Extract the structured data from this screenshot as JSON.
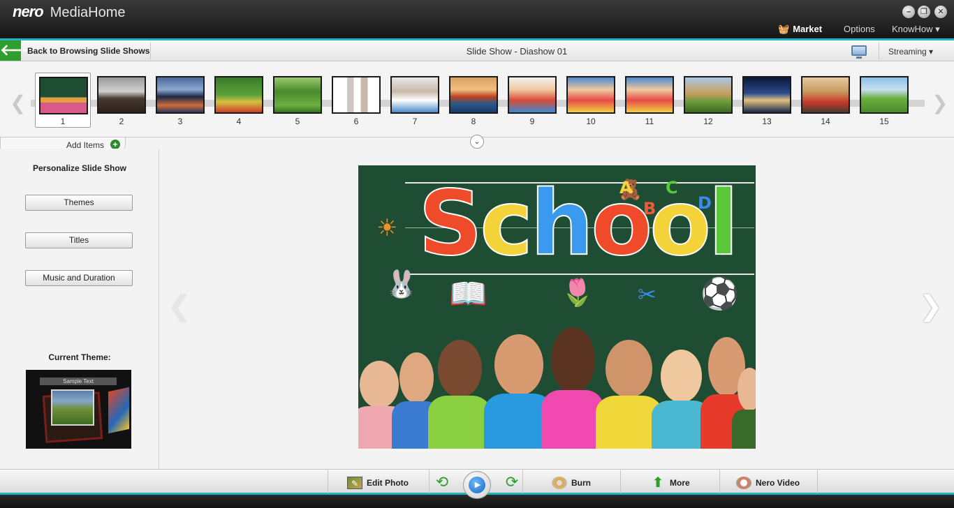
{
  "titlebar": {
    "brand": "nero",
    "app_name": "MediaHome",
    "window_controls": {
      "minimize_icon": "minimize-icon",
      "restore_icon": "restore-icon",
      "close_icon": "close-icon"
    },
    "menu": {
      "market": "Market",
      "options": "Options",
      "knowhow": "KnowHow"
    }
  },
  "navbar": {
    "back_label": "Back to Browsing Slide Shows",
    "title": "Slide Show - Diashow 01",
    "streaming_label": "Streaming",
    "icons": {
      "back": "back-arrow-icon",
      "monitor": "monitor-icon"
    }
  },
  "filmstrip": {
    "selected_index": 1,
    "thumbnails": [
      {
        "number": "1"
      },
      {
        "number": "2"
      },
      {
        "number": "3"
      },
      {
        "number": "4"
      },
      {
        "number": "5"
      },
      {
        "number": "6"
      },
      {
        "number": "7"
      },
      {
        "number": "8"
      },
      {
        "number": "9"
      },
      {
        "number": "10"
      },
      {
        "number": "11"
      },
      {
        "number": "12"
      },
      {
        "number": "13"
      },
      {
        "number": "14"
      },
      {
        "number": "15"
      }
    ],
    "add_items_label": "Add Items"
  },
  "left_panel": {
    "heading": "Personalize Slide Show",
    "buttons": {
      "themes": "Themes",
      "titles": "Titles",
      "music": "Music and Duration"
    },
    "current_theme_label": "Current Theme:",
    "theme_sample_text": "Sample Text"
  },
  "main_photo": {
    "headline": "School",
    "doodles": {
      "abc_a": "A",
      "abc_b": "B",
      "abc_c": "C",
      "abc_d": "D"
    }
  },
  "bottombar": {
    "edit_photo": "Edit Photo",
    "burn": "Burn",
    "more": "More",
    "nero_video": "Nero Video"
  },
  "colors": {
    "accent": "#1cb5c4",
    "back_green": "#2e9e2e",
    "chalkboard": "#1f4d33"
  }
}
